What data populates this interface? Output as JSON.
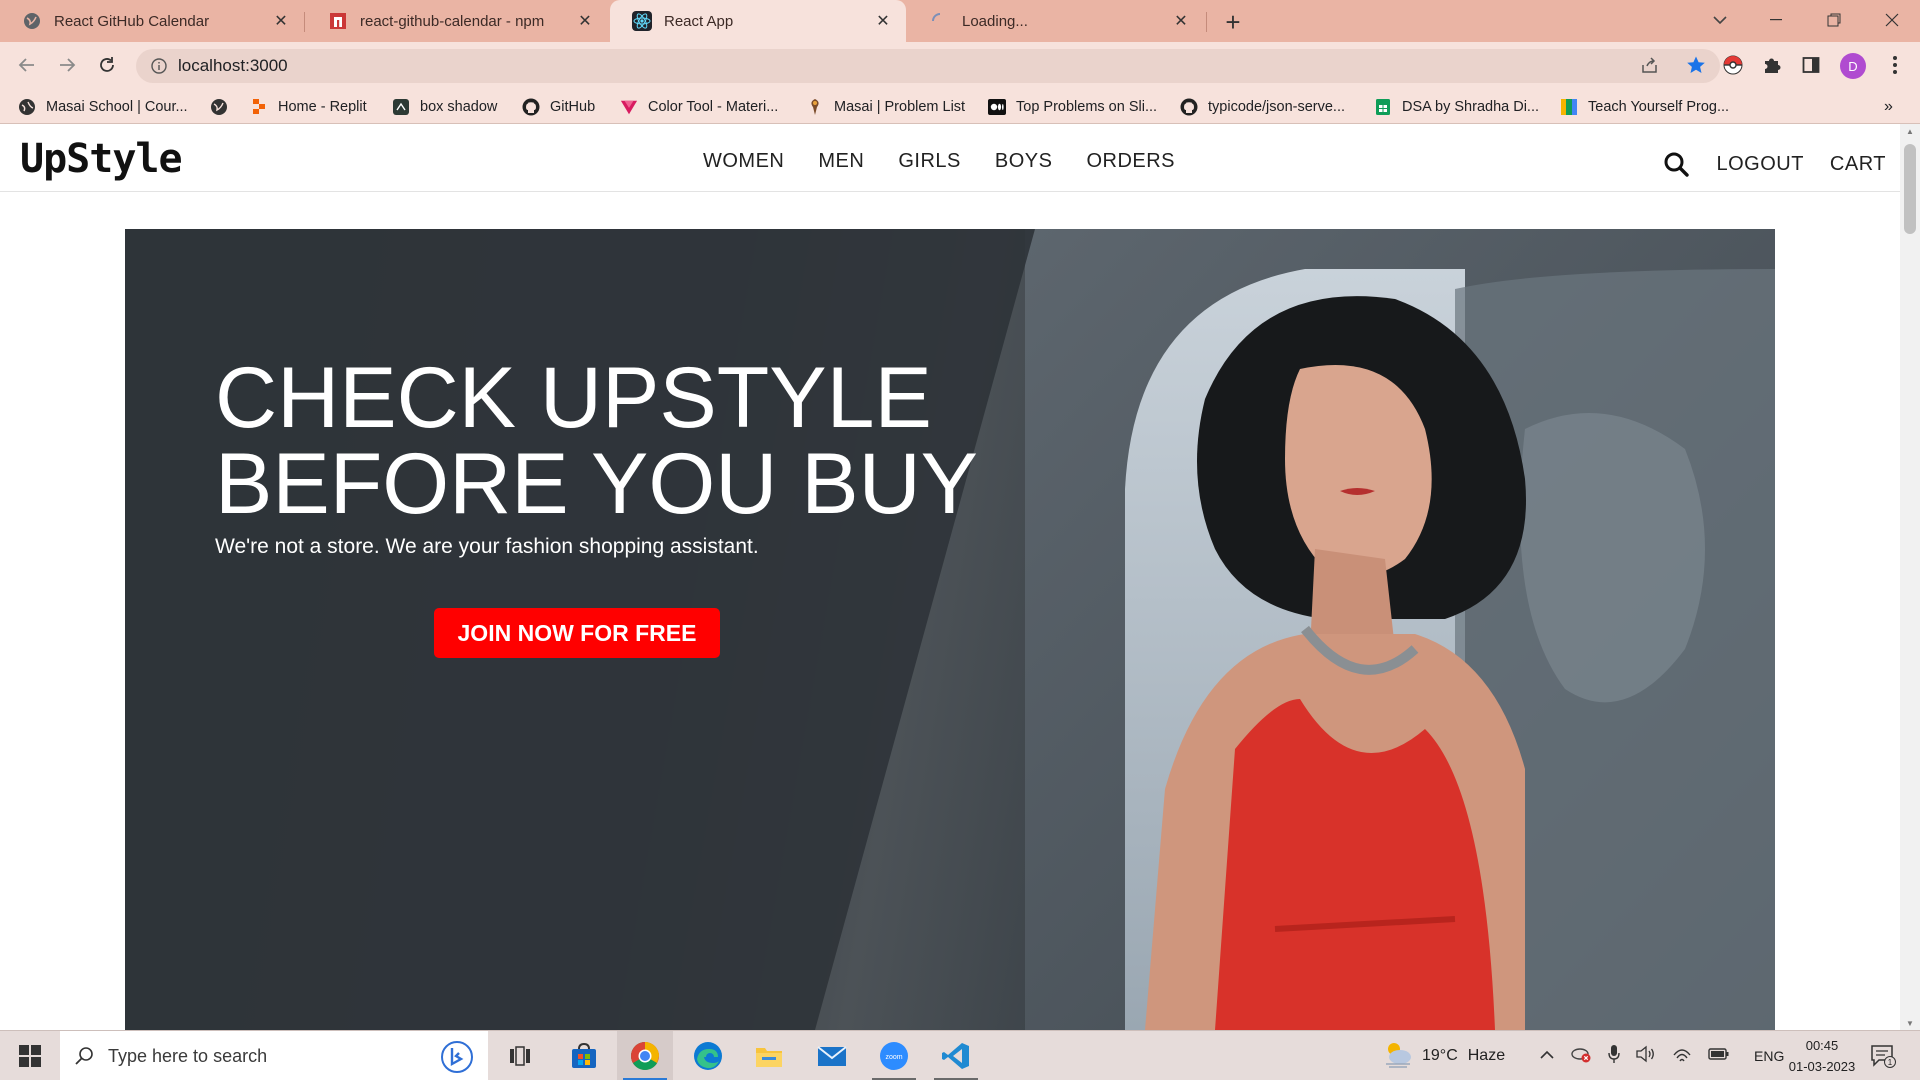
{
  "browser": {
    "tabs": [
      {
        "title": "React GitHub Calendar",
        "icon": "globe-icon",
        "active": false
      },
      {
        "title": "react-github-calendar - npm",
        "icon": "npm-icon",
        "active": false
      },
      {
        "title": "React App",
        "icon": "react-icon",
        "active": true
      },
      {
        "title": "Loading...",
        "icon": "loading-spinner-icon",
        "active": false
      }
    ],
    "address": "localhost:3000",
    "profile_initial": "D",
    "bookmarks": [
      {
        "label": "Masai School | Cour...",
        "icon": "masai-icon"
      },
      {
        "label": "",
        "icon": "globe-icon"
      },
      {
        "label": "Home - Replit",
        "icon": "replit-icon"
      },
      {
        "label": "box shadow",
        "icon": "box-shadow-icon"
      },
      {
        "label": "GitHub",
        "icon": "github-icon"
      },
      {
        "label": "Color Tool - Materi...",
        "icon": "material-icon"
      },
      {
        "label": "Masai | Problem List",
        "icon": "masai-problem-icon"
      },
      {
        "label": "Top Problems on Sli...",
        "icon": "medium-icon"
      },
      {
        "label": "typicode/json-serve...",
        "icon": "github-icon"
      },
      {
        "label": "DSA by Shradha Di...",
        "icon": "sheets-icon"
      },
      {
        "label": "Teach Yourself Prog...",
        "icon": "teach-icon"
      }
    ],
    "colors": {
      "tabbar": "#eab4a4",
      "toolbar": "#f7e2dc"
    }
  },
  "site": {
    "logo": "UpStyle",
    "menu": [
      "WOMEN",
      "MEN",
      "GIRLS",
      "BOYS",
      "ORDERS"
    ],
    "account": {
      "logout": "LOGOUT",
      "cart": "CART"
    },
    "hero": {
      "headline_line1": "CHECK UPSTYLE",
      "headline_line2": "BEFORE YOU BUY",
      "subtitle": "We're not a store. We are your fashion shopping assistant.",
      "cta": "JOIN NOW FOR FREE",
      "cta_color": "#ff0000"
    }
  },
  "taskbar": {
    "search_placeholder": "Type here to search",
    "weather": {
      "temp": "19°C",
      "condition": "Haze"
    },
    "language": "ENG",
    "time": "00:45",
    "date": "01-03-2023",
    "notification_count": "1",
    "apps": [
      "task-view-icon",
      "store-icon",
      "chrome-icon",
      "edge-icon",
      "file-explorer-icon",
      "mail-icon",
      "zoom-icon",
      "vscode-icon"
    ]
  }
}
